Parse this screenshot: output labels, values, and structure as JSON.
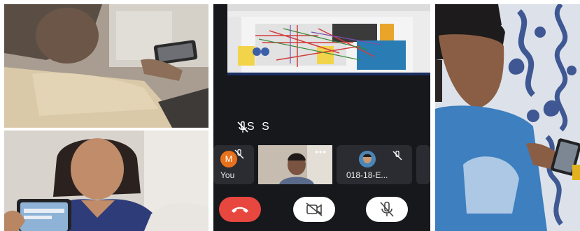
{
  "meeting": {
    "presenter_name": "S S",
    "participants": [
      {
        "label": "You",
        "initial": "M"
      },
      {
        "label": "018-18-E..."
      }
    ],
    "controls": [
      "end-call",
      "camera-off",
      "mic-off"
    ]
  }
}
